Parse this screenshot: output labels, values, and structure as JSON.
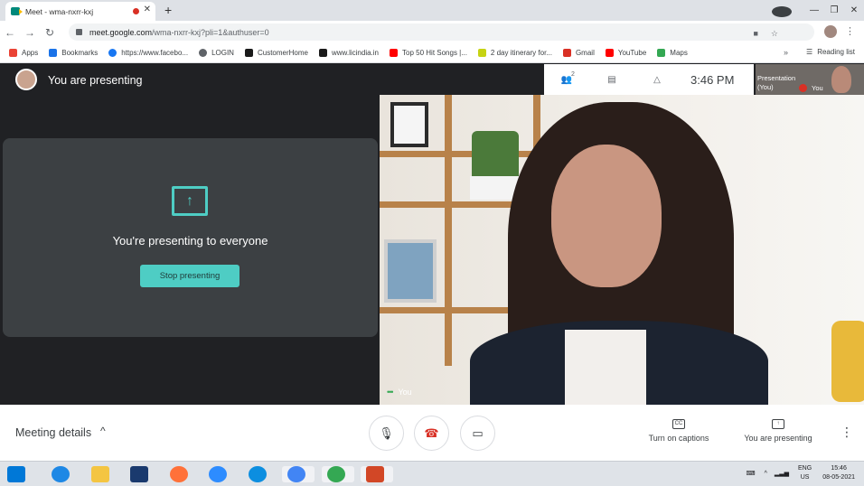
{
  "browser": {
    "tab_title": "Meet - wma-nxrr-kxj",
    "new_tab_icon": "+",
    "url_main": "meet.google.com",
    "url_rest": "/wma-nxrr-kxj?pli=1&authuser=0",
    "bookmarks": [
      {
        "label": "Apps",
        "color": "#ea4335"
      },
      {
        "label": "Bookmarks",
        "color": "#1a73e8"
      },
      {
        "label": "https://www.facebo...",
        "color": "#1877f2"
      },
      {
        "label": "LOGIN",
        "color": "#5f6368"
      },
      {
        "label": "CustomerHome",
        "color": "#1a1a1a"
      },
      {
        "label": "www.licindia.in",
        "color": "#1a1a1a"
      },
      {
        "label": "Top 50 Hit Songs |...",
        "color": "#ff0000"
      },
      {
        "label": "2 day itinerary for...",
        "color": "#c6d313"
      },
      {
        "label": "Gmail",
        "color": "#d93025"
      },
      {
        "label": "YouTube",
        "color": "#ff0000"
      },
      {
        "label": "Maps",
        "color": "#34a853"
      }
    ],
    "reading_list": "Reading list",
    "more_bookmarks": "»"
  },
  "meet": {
    "presenting_title": "You are presenting",
    "participants_badge": "2",
    "time": "3:46 PM",
    "thumb_label_1": "Presentation",
    "thumb_label_2": "(You)",
    "thumb_you": "You",
    "present_message": "You're presenting to everyone",
    "stop_presenting": "Stop presenting",
    "video_label": "You"
  },
  "bottom": {
    "meeting_details": "Meeting details",
    "captions": "Turn on captions",
    "captions_icon_text": "CC",
    "you_are_presenting": "You are presenting"
  },
  "taskbar": {
    "lang_1": "ENG",
    "lang_2": "US",
    "time": "15:46",
    "date": "08-05-2021"
  },
  "colors": {
    "accent": "#4ecdc4",
    "end_call": "#d93025",
    "meet_bg": "#202124"
  }
}
